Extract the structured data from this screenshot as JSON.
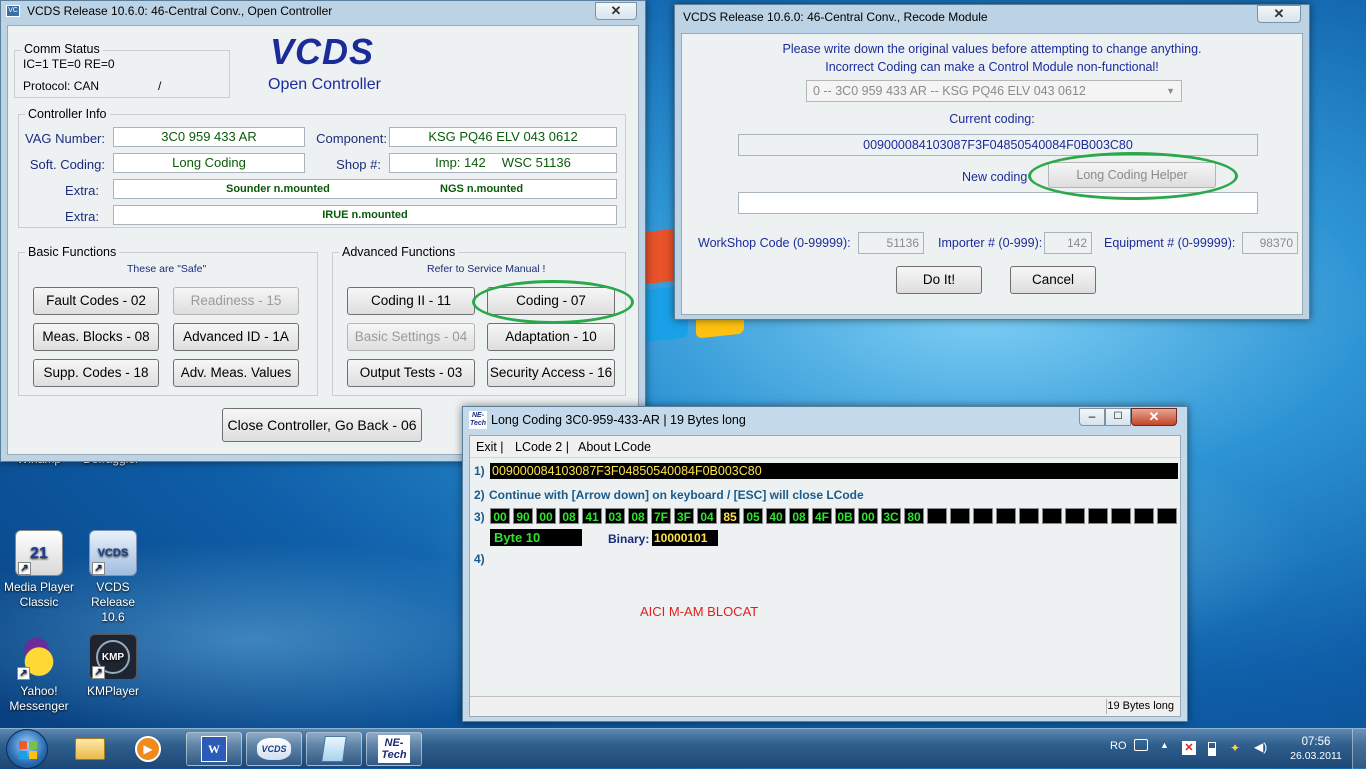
{
  "desktop": {
    "icons": [
      {
        "label": "Winamp",
        "icon": "winamp-icon"
      },
      {
        "label": "Defraggler",
        "icon": "defraggler-icon"
      },
      {
        "label": "Media Player Classic",
        "line1": "Media Player",
        "line2": "Classic",
        "icon": "media-player-classic-icon"
      },
      {
        "label": "VCDS Release 10.6",
        "line1": "VCDS Release",
        "line2": "10.6",
        "icon": "vcds-icon"
      },
      {
        "label": "Yahoo! Messenger",
        "line1": "Yahoo!",
        "line2": "Messenger",
        "icon": "yahoo-messenger-icon"
      },
      {
        "label": "KMPlayer",
        "icon": "kmplayer-icon"
      }
    ],
    "mpc_badge": "21",
    "vcds_badge": "VCDS",
    "kmp_badge": "KMP"
  },
  "open_controller": {
    "title": "VCDS Release 10.6.0: 46-Central Conv.,  Open Controller",
    "comm_status": {
      "label": "Comm Status",
      "line1": "IC=1  TE=0  RE=0",
      "protocol": "Protocol: CAN",
      "slash": "/"
    },
    "brand": "VCDS",
    "subtitle": "Open Controller",
    "controller_info": {
      "label": "Controller Info",
      "vag_label": "VAG Number:",
      "vag_value": "3C0 959 433 AR",
      "component_label": "Component:",
      "component_value": "KSG PQ46 ELV 043 0612",
      "soft_coding_label": "Soft. Coding:",
      "soft_coding_value": "Long Coding",
      "shop_label": "Shop #:",
      "shop_imp": "Imp: 142",
      "shop_wsc": "WSC 51136",
      "extra_label": "Extra:",
      "extra1_a": "Sounder n.mounted",
      "extra1_b": "NGS n.mounted",
      "extra2": "IRUE n.mounted"
    },
    "basic": {
      "label": "Basic Functions",
      "note": "These are \"Safe\"",
      "fault_codes": "Fault Codes - 02",
      "readiness": "Readiness - 15",
      "meas_blocks": "Meas. Blocks - 08",
      "advanced_id": "Advanced ID - 1A",
      "supp_codes": "Supp. Codes - 18",
      "adv_meas": "Adv. Meas. Values"
    },
    "advanced": {
      "label": "Advanced Functions",
      "note": "Refer to Service Manual !",
      "coding2": "Coding II - 11",
      "coding": "Coding - 07",
      "basic_settings": "Basic Settings - 04",
      "adaptation": "Adaptation - 10",
      "output_tests": "Output Tests - 03",
      "security_access": "Security Access - 16"
    },
    "close_button": "Close Controller, Go Back - 06"
  },
  "recode": {
    "title": "VCDS Release 10.6.0: 46-Central Conv.,  Recode Module",
    "warning1": "Please write down the original values before attempting to change anything.",
    "warning2": "Incorrect Coding can make a Control Module non-functional!",
    "module_select": "0 -- 3C0 959 433 AR --     KSG PQ46 ELV 043 0612",
    "current_coding_label": "Current coding:",
    "current_coding_value": "009000084103087F3F04850540084F0B003C80",
    "new_coding_label": "New coding",
    "long_coding_helper": "Long Coding Helper",
    "new_coding_value": "",
    "workshop_label": "WorkShop Code (0-99999):",
    "workshop_value": "51136",
    "importer_label": "Importer # (0-999):",
    "importer_value": "142",
    "equipment_label": "Equipment # (0-99999):",
    "equipment_value": "98370",
    "do_it": "Do It!",
    "cancel": "Cancel"
  },
  "lcode": {
    "title": "Long Coding  3C0-959-433-AR | 19 Bytes long",
    "badge_line1": "NE-",
    "badge_line2": "Tech",
    "menu": [
      "Exit |",
      "LCode 2 |",
      "About LCode"
    ],
    "row1_num": "1)",
    "row1_value": "009000084103087F3F04850540084F0B003C80",
    "row2_num": "2)",
    "row2_text": "Continue with [Arrow down] on keyboard / [ESC] will close LCode",
    "row3_num": "3)",
    "bytes": [
      "00",
      "90",
      "00",
      "08",
      "41",
      "03",
      "08",
      "7F",
      "3F",
      "04",
      "85",
      "05",
      "40",
      "08",
      "4F",
      "0B",
      "00",
      "3C",
      "80",
      "",
      "",
      "",
      "",
      "",
      "",
      "",
      "",
      "",
      "",
      ""
    ],
    "highlight_index": 10,
    "byte_label": "Byte 10",
    "binary_label": "Binary:",
    "binary_value": "10000101",
    "row4_num": "4)",
    "note": "AICI M-AM BLOCAT",
    "status": "19 Bytes long"
  },
  "taskbar": {
    "lang": "RO",
    "time": "07:56",
    "date": "26.03.2011",
    "ne_badge1": "NE-",
    "ne_badge2": "Tech",
    "vcds_badge": "VCDS"
  }
}
